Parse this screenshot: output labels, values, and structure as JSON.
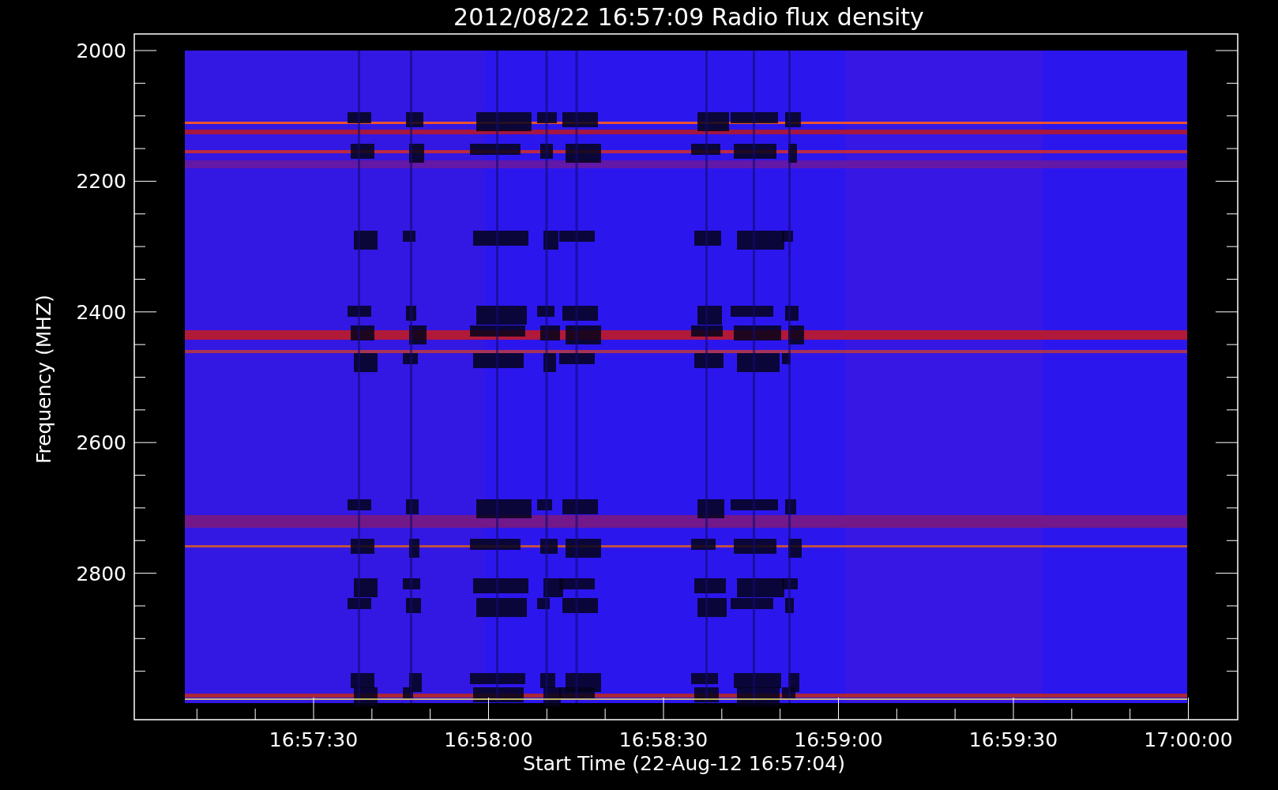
{
  "title": "2012/08/22 16:57:09 Radio flux density",
  "y_axis": {
    "label": "Frequency (MHZ)",
    "ticks": [
      "2000",
      "2200",
      "2400",
      "2600",
      "2800"
    ]
  },
  "x_axis": {
    "label": "Start Time (22-Aug-12 16:57:04)",
    "ticks": [
      "16:57:30",
      "16:58:00",
      "16:58:30",
      "16:59:00",
      "16:59:30",
      "17:00:00"
    ]
  }
}
